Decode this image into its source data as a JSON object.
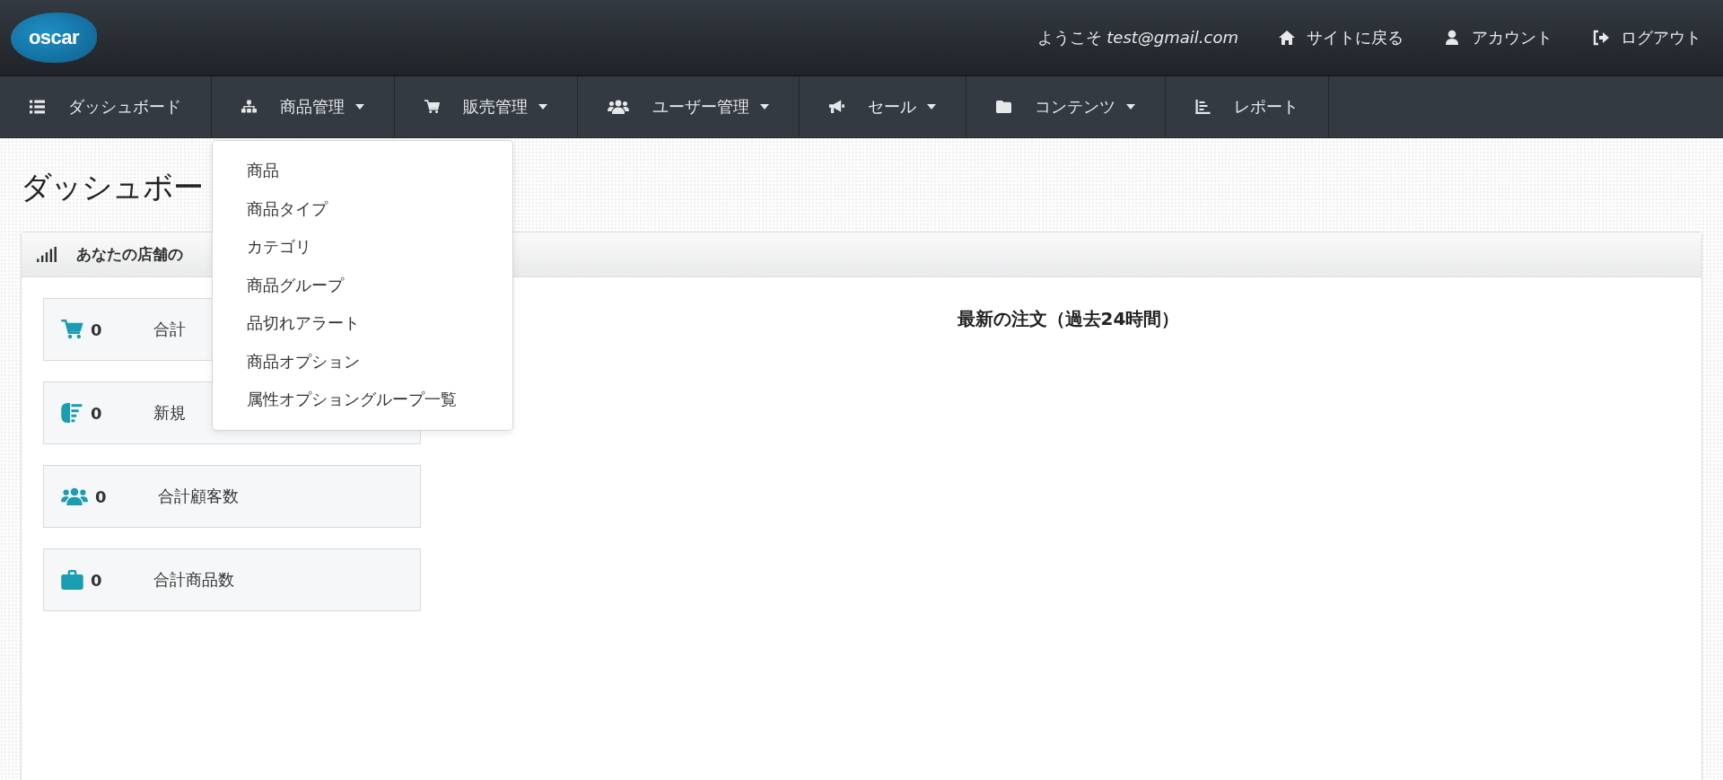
{
  "header": {
    "logo": "oscar",
    "welcome": "ようこそ *test@gmail.com*",
    "links": [
      {
        "label": "サイトに戻る"
      },
      {
        "label": "アカウント"
      },
      {
        "label": "ログアウト"
      }
    ]
  },
  "nav": [
    {
      "label": "ダッシュボード",
      "caret": false,
      "expanded": false
    },
    {
      "label": "商品管理",
      "caret": true,
      "expanded": true,
      "menu": [
        "商品",
        "商品タイプ",
        "カテゴリ",
        "商品グループ",
        "品切れアラート",
        "商品オプション",
        "属性オプショングループ一覧"
      ]
    },
    {
      "label": "販売管理",
      "caret": true,
      "expanded": false
    },
    {
      "label": "ユーザー管理",
      "caret": true,
      "expanded": false
    },
    {
      "label": "セール",
      "caret": true,
      "expanded": false
    },
    {
      "label": "コンテンツ",
      "caret": true,
      "expanded": false
    },
    {
      "label": "レポート",
      "caret": false,
      "expanded": false
    }
  ],
  "page_title": "ダッシュボー",
  "panel": {
    "title": "あなたの店舗の",
    "stats": [
      {
        "value": "0",
        "label": "合計"
      },
      {
        "value": "0",
        "label": "新規"
      },
      {
        "value": "0",
        "label": "合計顧客数"
      },
      {
        "value": "0",
        "label": "合計商品数"
      }
    ],
    "orders_heading": "最新の注文（過去24時間）"
  }
}
